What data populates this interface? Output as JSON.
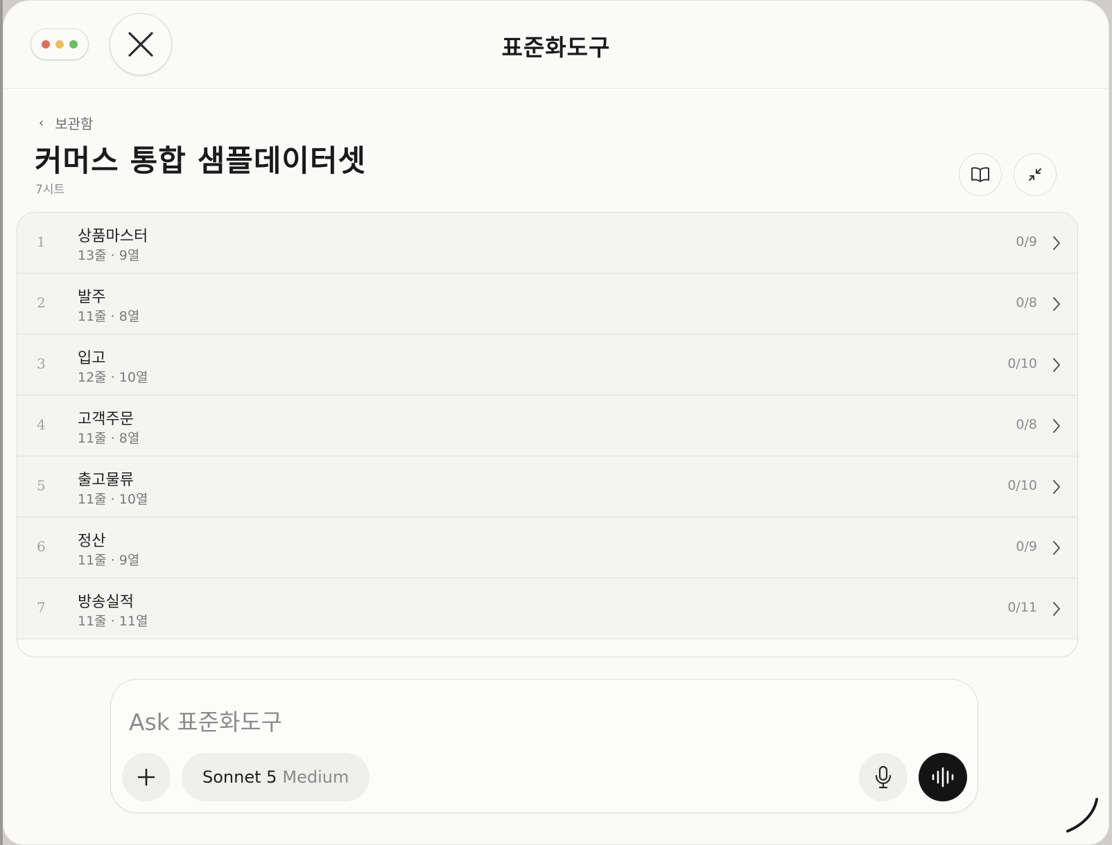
{
  "window": {
    "title": "표준화도구",
    "traffic_colors": [
      "#e06c5c",
      "#e8c15a",
      "#6cc05f"
    ]
  },
  "header": {
    "back_label": "보관함",
    "title": "커머스 통합 샘플데이터셋",
    "sheet_count": "7시트"
  },
  "icons": {
    "close": "close-icon",
    "back": "chevron-left-icon",
    "book": "book-icon",
    "collapse": "collapse-icon",
    "row_arrow": "chevron-right-icon",
    "plus": "plus-icon",
    "mic": "microphone-icon",
    "voice": "voice-wave-icon"
  },
  "sheets": [
    {
      "index": "1",
      "name": "상품마스터",
      "meta": "13줄 · 9열",
      "progress": "0/9"
    },
    {
      "index": "2",
      "name": "발주",
      "meta": "11줄 · 8열",
      "progress": "0/8"
    },
    {
      "index": "3",
      "name": "입고",
      "meta": "12줄 · 10열",
      "progress": "0/10"
    },
    {
      "index": "4",
      "name": "고객주문",
      "meta": "11줄 · 8열",
      "progress": "0/8"
    },
    {
      "index": "5",
      "name": "출고물류",
      "meta": "11줄 · 10열",
      "progress": "0/10"
    },
    {
      "index": "6",
      "name": "정산",
      "meta": "11줄 · 9열",
      "progress": "0/9"
    },
    {
      "index": "7",
      "name": "방송실적",
      "meta": "11줄 · 11열",
      "progress": "0/11"
    }
  ],
  "composer": {
    "placeholder": "Ask 표준화도구",
    "model_name": "Sonnet 5",
    "model_mode": "Medium"
  }
}
